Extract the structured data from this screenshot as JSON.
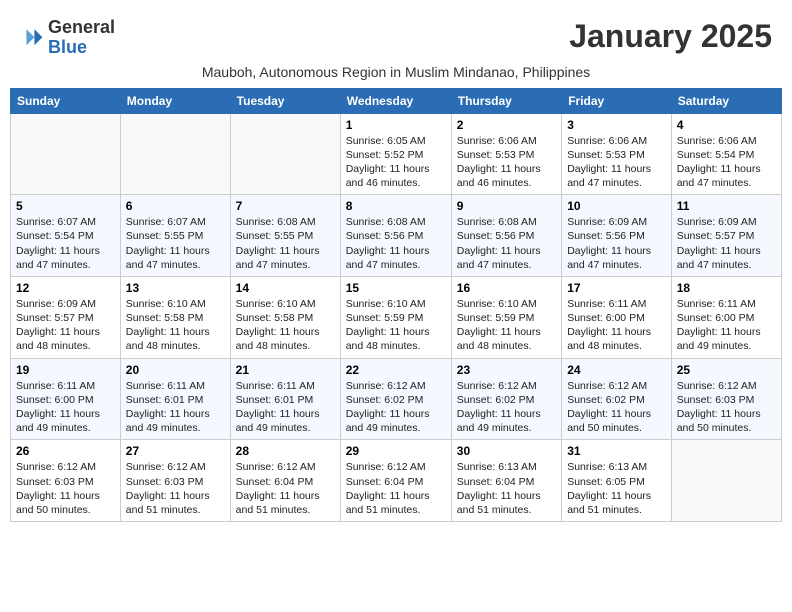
{
  "logo": {
    "general": "General",
    "blue": "Blue"
  },
  "title": "January 2025",
  "subtitle": "Mauboh, Autonomous Region in Muslim Mindanao, Philippines",
  "weekdays": [
    "Sunday",
    "Monday",
    "Tuesday",
    "Wednesday",
    "Thursday",
    "Friday",
    "Saturday"
  ],
  "weeks": [
    [
      {
        "day": "",
        "info": ""
      },
      {
        "day": "",
        "info": ""
      },
      {
        "day": "",
        "info": ""
      },
      {
        "day": "1",
        "info": "Sunrise: 6:05 AM\nSunset: 5:52 PM\nDaylight: 11 hours and 46 minutes."
      },
      {
        "day": "2",
        "info": "Sunrise: 6:06 AM\nSunset: 5:53 PM\nDaylight: 11 hours and 46 minutes."
      },
      {
        "day": "3",
        "info": "Sunrise: 6:06 AM\nSunset: 5:53 PM\nDaylight: 11 hours and 47 minutes."
      },
      {
        "day": "4",
        "info": "Sunrise: 6:06 AM\nSunset: 5:54 PM\nDaylight: 11 hours and 47 minutes."
      }
    ],
    [
      {
        "day": "5",
        "info": "Sunrise: 6:07 AM\nSunset: 5:54 PM\nDaylight: 11 hours and 47 minutes."
      },
      {
        "day": "6",
        "info": "Sunrise: 6:07 AM\nSunset: 5:55 PM\nDaylight: 11 hours and 47 minutes."
      },
      {
        "day": "7",
        "info": "Sunrise: 6:08 AM\nSunset: 5:55 PM\nDaylight: 11 hours and 47 minutes."
      },
      {
        "day": "8",
        "info": "Sunrise: 6:08 AM\nSunset: 5:56 PM\nDaylight: 11 hours and 47 minutes."
      },
      {
        "day": "9",
        "info": "Sunrise: 6:08 AM\nSunset: 5:56 PM\nDaylight: 11 hours and 47 minutes."
      },
      {
        "day": "10",
        "info": "Sunrise: 6:09 AM\nSunset: 5:56 PM\nDaylight: 11 hours and 47 minutes."
      },
      {
        "day": "11",
        "info": "Sunrise: 6:09 AM\nSunset: 5:57 PM\nDaylight: 11 hours and 47 minutes."
      }
    ],
    [
      {
        "day": "12",
        "info": "Sunrise: 6:09 AM\nSunset: 5:57 PM\nDaylight: 11 hours and 48 minutes."
      },
      {
        "day": "13",
        "info": "Sunrise: 6:10 AM\nSunset: 5:58 PM\nDaylight: 11 hours and 48 minutes."
      },
      {
        "day": "14",
        "info": "Sunrise: 6:10 AM\nSunset: 5:58 PM\nDaylight: 11 hours and 48 minutes."
      },
      {
        "day": "15",
        "info": "Sunrise: 6:10 AM\nSunset: 5:59 PM\nDaylight: 11 hours and 48 minutes."
      },
      {
        "day": "16",
        "info": "Sunrise: 6:10 AM\nSunset: 5:59 PM\nDaylight: 11 hours and 48 minutes."
      },
      {
        "day": "17",
        "info": "Sunrise: 6:11 AM\nSunset: 6:00 PM\nDaylight: 11 hours and 48 minutes."
      },
      {
        "day": "18",
        "info": "Sunrise: 6:11 AM\nSunset: 6:00 PM\nDaylight: 11 hours and 49 minutes."
      }
    ],
    [
      {
        "day": "19",
        "info": "Sunrise: 6:11 AM\nSunset: 6:00 PM\nDaylight: 11 hours and 49 minutes."
      },
      {
        "day": "20",
        "info": "Sunrise: 6:11 AM\nSunset: 6:01 PM\nDaylight: 11 hours and 49 minutes."
      },
      {
        "day": "21",
        "info": "Sunrise: 6:11 AM\nSunset: 6:01 PM\nDaylight: 11 hours and 49 minutes."
      },
      {
        "day": "22",
        "info": "Sunrise: 6:12 AM\nSunset: 6:02 PM\nDaylight: 11 hours and 49 minutes."
      },
      {
        "day": "23",
        "info": "Sunrise: 6:12 AM\nSunset: 6:02 PM\nDaylight: 11 hours and 49 minutes."
      },
      {
        "day": "24",
        "info": "Sunrise: 6:12 AM\nSunset: 6:02 PM\nDaylight: 11 hours and 50 minutes."
      },
      {
        "day": "25",
        "info": "Sunrise: 6:12 AM\nSunset: 6:03 PM\nDaylight: 11 hours and 50 minutes."
      }
    ],
    [
      {
        "day": "26",
        "info": "Sunrise: 6:12 AM\nSunset: 6:03 PM\nDaylight: 11 hours and 50 minutes."
      },
      {
        "day": "27",
        "info": "Sunrise: 6:12 AM\nSunset: 6:03 PM\nDaylight: 11 hours and 51 minutes."
      },
      {
        "day": "28",
        "info": "Sunrise: 6:12 AM\nSunset: 6:04 PM\nDaylight: 11 hours and 51 minutes."
      },
      {
        "day": "29",
        "info": "Sunrise: 6:12 AM\nSunset: 6:04 PM\nDaylight: 11 hours and 51 minutes."
      },
      {
        "day": "30",
        "info": "Sunrise: 6:13 AM\nSunset: 6:04 PM\nDaylight: 11 hours and 51 minutes."
      },
      {
        "day": "31",
        "info": "Sunrise: 6:13 AM\nSunset: 6:05 PM\nDaylight: 11 hours and 51 minutes."
      },
      {
        "day": "",
        "info": ""
      }
    ]
  ]
}
